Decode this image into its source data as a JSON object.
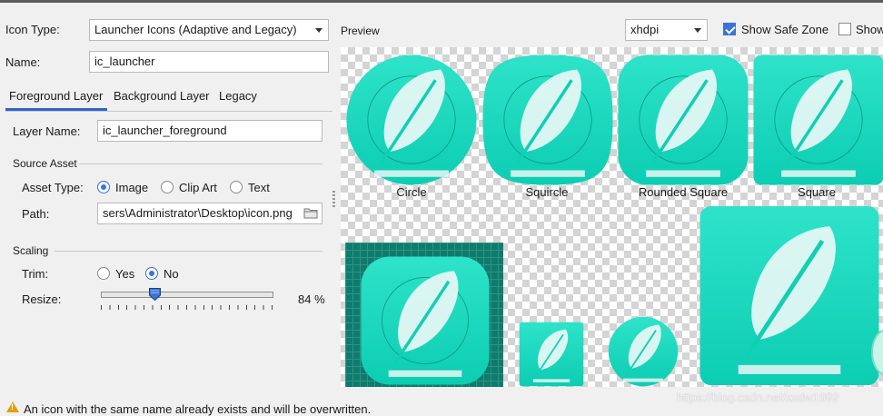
{
  "form": {
    "icon_type_label": "Icon Type:",
    "icon_type_value": "Launcher Icons (Adaptive and Legacy)",
    "name_label": "Name:",
    "name_value": "ic_launcher"
  },
  "tabs": [
    "Foreground Layer",
    "Background Layer",
    "Legacy"
  ],
  "layer": {
    "layer_name_label": "Layer Name:",
    "layer_name_value": "ic_launcher_foreground",
    "source_asset_title": "Source Asset",
    "asset_type_label": "Asset Type:",
    "asset_type_options": [
      "Image",
      "Clip Art",
      "Text"
    ],
    "asset_type_selected": "Image",
    "path_label": "Path:",
    "path_value": "sers\\Administrator\\Desktop\\icon.png"
  },
  "scaling": {
    "title": "Scaling",
    "trim_label": "Trim:",
    "trim_options": [
      "Yes",
      "No"
    ],
    "trim_selected": "No",
    "resize_label": "Resize:",
    "resize_percent": 84,
    "resize_text": "84 %"
  },
  "preview": {
    "title": "Preview",
    "density_value": "xhdpi",
    "show_safe_zone_label": "Show Safe Zone",
    "show_safe_zone_checked": true,
    "show_grid_label": "Show",
    "show_grid_checked": false,
    "icon_labels": [
      "Circle",
      "Squircle",
      "Rounded Square",
      "Square"
    ]
  },
  "warning_text": "An icon with the same name already exists and will be overwritten.",
  "watermark": "https://blog.csdn.net/xxdw1992",
  "colors": {
    "icon_teal": "#14d6bb",
    "icon_teal_light": "#3fe8cf",
    "grid_bg": "#107a6c",
    "accent_blue": "#3d72d6",
    "warning": "#e0a000"
  }
}
